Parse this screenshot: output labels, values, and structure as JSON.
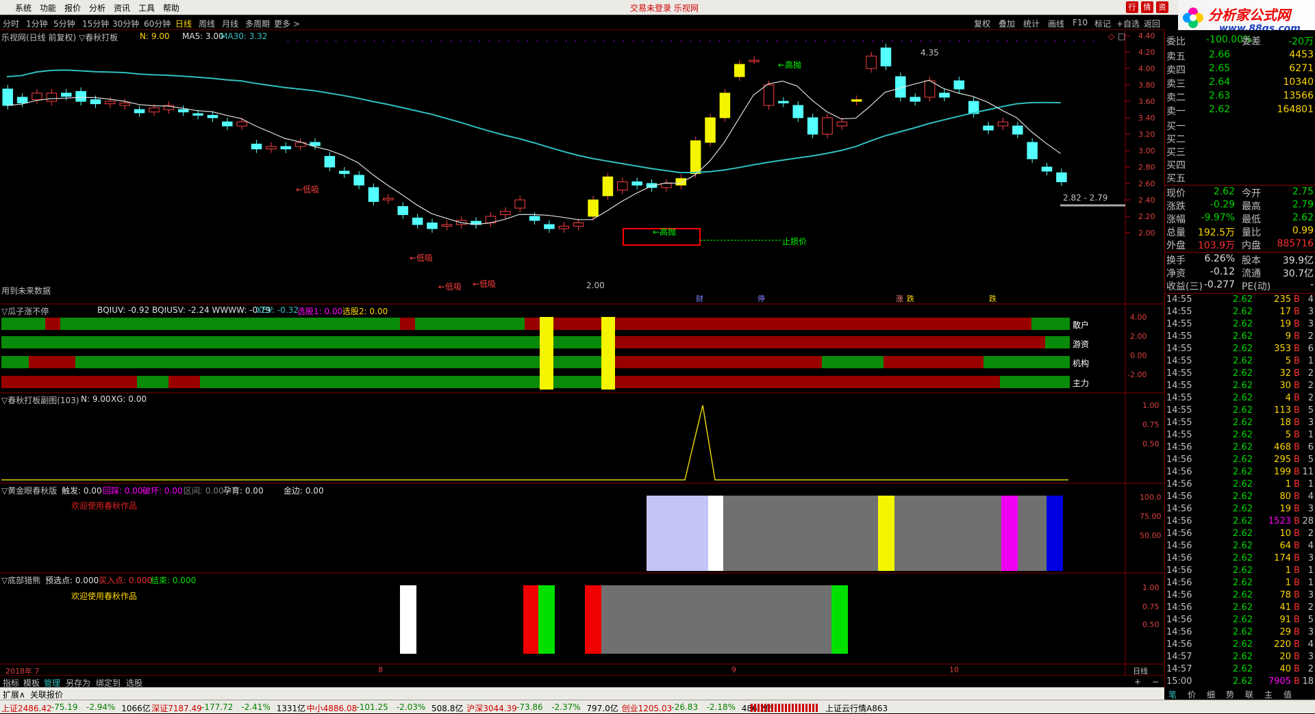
{
  "menu": {
    "items": [
      "系统",
      "功能",
      "报价",
      "分析",
      "资讯",
      "工具",
      "帮助"
    ],
    "title": "交易未登录 乐视网",
    "btn_trade": "行",
    "btn_info": "情",
    "btn_zi": "资"
  },
  "logo": {
    "text": "分析家公式网",
    "url": "www.88gs.com"
  },
  "tabs": {
    "periods": [
      "分时",
      "1分钟",
      "5分钟",
      "15分钟",
      "30分钟",
      "60分钟",
      "日线",
      "周线",
      "月线",
      "多周期",
      "更多 >"
    ],
    "right": [
      "复权",
      "叠加",
      "统计",
      "画线",
      "F10",
      "标记",
      "+自选",
      "返回"
    ]
  },
  "main": {
    "title": "乐视网(日线 前复权) ▽春秋打板",
    "n_label": "N: 9.00",
    "ma5": "MA5: 3.00",
    "ma30": "MA30: 3.32",
    "future_note": "用到未来数据",
    "annotations": {
      "high_sell1": "←高抛",
      "high_sell2": "←高抛",
      "low_buy1": "←低吸",
      "low_buy2": "←低吸",
      "low_buy3": "←低吸",
      "low_buy4": "←低吸",
      "stop": "止损价",
      "peak": "4.35",
      "trough": "2.00",
      "last": "2.82 - 2.79"
    },
    "markers": [
      "财",
      "停",
      "涨",
      "跌",
      "跌"
    ],
    "yticks": [
      "4.40",
      "4.20",
      "4.00",
      "3.80",
      "3.60",
      "3.40",
      "3.20",
      "3.00",
      "2.80",
      "2.60",
      "2.40",
      "2.20",
      "2.00"
    ]
  },
  "panel2": {
    "title": "▽瓜子涨不停",
    "stats": "BQIUV: -0.92 BQIUSV: -2.24 WWWW: -0.79",
    "xev": "XEV: -0.32",
    "xg1": "选股1: 0.00",
    "xg2": "选股2: 0.00",
    "rows": [
      "散户",
      "游资",
      "机构",
      "主力"
    ],
    "yticks": [
      "4.00",
      "2.00",
      "0.00",
      "-2.00"
    ]
  },
  "panel3": {
    "title": "▽春秋打板副图(103)",
    "n": "N: 9.00",
    "xg": "XG: 0.00",
    "yticks": [
      "1.00",
      "0.75",
      "0.50"
    ]
  },
  "panel4": {
    "title": "▽黄金眼春秋版",
    "f1": "触发: 0.00",
    "f2": "回踩: 0.00",
    "f3": "破坏: 0.00",
    "f4": "区间: 0.00",
    "f5": "孕育: 0.00",
    "f6": "金边: 0.00",
    "welcome": "欢迎使用春秋作品",
    "yticks": [
      "100.0",
      "75.00",
      "50.00"
    ]
  },
  "panel5": {
    "title": "▽底部猎熊",
    "f1": "预选点: 0.000",
    "f2": "买入点: 0.000",
    "f3": "结束: 0.000",
    "welcome": "欢迎使用春秋作品",
    "yticks": [
      "1.00",
      "0.75",
      "0.50"
    ]
  },
  "xaxis": {
    "labels": [
      "2018年 7",
      "8",
      "9",
      "10"
    ],
    "right": "日线"
  },
  "bottom": {
    "tabs": [
      "指标",
      "模板",
      "管理",
      "另存为",
      "绑定到",
      "选股"
    ],
    "exp": [
      "扩展∧",
      "关联报价"
    ],
    "qtabs": [
      "笔",
      "价",
      "细",
      "势",
      "联",
      "主",
      "值"
    ]
  },
  "quote": {
    "top": {
      "l": "委比",
      "m": "-100.00%",
      "l2": "委差",
      "r": "-20万"
    },
    "sells": [
      {
        "l": "卖五",
        "p": "2.66",
        "v": "4453"
      },
      {
        "l": "卖四",
        "p": "2.65",
        "v": "6271"
      },
      {
        "l": "卖三",
        "p": "2.64",
        "v": "10340"
      },
      {
        "l": "卖二",
        "p": "2.63",
        "v": "13566"
      },
      {
        "l": "卖一",
        "p": "2.62",
        "v": "164801"
      }
    ],
    "buys": [
      "买一",
      "买二",
      "买三",
      "买四",
      "买五"
    ],
    "info": [
      {
        "a": "现价",
        "b": "2.62",
        "c": "今开",
        "d": "2.75"
      },
      {
        "a": "涨跌",
        "b": "-0.29",
        "c": "最高",
        "d": "2.79"
      },
      {
        "a": "涨幅",
        "b": "-9.97%",
        "c": "最低",
        "d": "2.62"
      },
      {
        "a": "总量",
        "b": "192.5万",
        "c": "量比",
        "d": "0.99"
      },
      {
        "a": "外盘",
        "b": "103.9万",
        "c": "内盘",
        "d": "885716"
      }
    ],
    "info2": [
      {
        "a": "换手",
        "b": "6.26%",
        "c": "股本",
        "d": "39.9亿"
      },
      {
        "a": "净资",
        "b": "-0.12",
        "c": "流通",
        "d": "30.7亿"
      },
      {
        "a": "收益(三)",
        "b": "-0.277",
        "c": "PE(动)",
        "d": "-"
      }
    ],
    "ticks": [
      [
        "14:55",
        "2.62",
        "235",
        "B",
        "4"
      ],
      [
        "14:55",
        "2.62",
        "17",
        "B",
        "3"
      ],
      [
        "14:55",
        "2.62",
        "19",
        "B",
        "3"
      ],
      [
        "14:55",
        "2.62",
        "9",
        "B",
        "2"
      ],
      [
        "14:55",
        "2.62",
        "353",
        "B",
        "6"
      ],
      [
        "14:55",
        "2.62",
        "5",
        "B",
        "1"
      ],
      [
        "14:55",
        "2.62",
        "32",
        "B",
        "2"
      ],
      [
        "14:55",
        "2.62",
        "30",
        "B",
        "2"
      ],
      [
        "14:55",
        "2.62",
        "4",
        "B",
        "2"
      ],
      [
        "14:55",
        "2.62",
        "113",
        "B",
        "5"
      ],
      [
        "14:55",
        "2.62",
        "18",
        "B",
        "3"
      ],
      [
        "14:55",
        "2.62",
        "5",
        "B",
        "1"
      ],
      [
        "14:56",
        "2.62",
        "468",
        "B",
        "6"
      ],
      [
        "14:56",
        "2.62",
        "295",
        "B",
        "5"
      ],
      [
        "14:56",
        "2.62",
        "199",
        "B",
        "11"
      ],
      [
        "14:56",
        "2.62",
        "1",
        "B",
        "1"
      ],
      [
        "14:56",
        "2.62",
        "80",
        "B",
        "4"
      ],
      [
        "14:56",
        "2.62",
        "19",
        "B",
        "3"
      ],
      [
        "14:56",
        "2.62",
        "1523",
        "B",
        "28"
      ],
      [
        "14:56",
        "2.62",
        "10",
        "B",
        "2"
      ],
      [
        "14:56",
        "2.62",
        "64",
        "B",
        "4"
      ],
      [
        "14:56",
        "2.62",
        "174",
        "B",
        "3"
      ],
      [
        "14:56",
        "2.62",
        "1",
        "B",
        "1"
      ],
      [
        "14:56",
        "2.62",
        "1",
        "B",
        "1"
      ],
      [
        "14:56",
        "2.62",
        "78",
        "B",
        "3"
      ],
      [
        "14:56",
        "2.62",
        "41",
        "B",
        "2"
      ],
      [
        "14:56",
        "2.62",
        "91",
        "B",
        "5"
      ],
      [
        "14:56",
        "2.62",
        "29",
        "B",
        "3"
      ],
      [
        "14:56",
        "2.62",
        "220",
        "B",
        "4"
      ],
      [
        "14:57",
        "2.62",
        "20",
        "B",
        "3"
      ],
      [
        "14:57",
        "2.62",
        "40",
        "B",
        "2"
      ],
      [
        "15:00",
        "2.62",
        "7905",
        "B",
        "18"
      ]
    ]
  },
  "status": [
    {
      "t": "上证2486.42",
      "c": "#c00"
    },
    {
      "t": "-75.19",
      "c": "#008000"
    },
    {
      "t": "-2.94%",
      "c": "#008000"
    },
    {
      "t": "1066亿",
      "c": "#000"
    },
    {
      "t": "深证7187.49",
      "c": "#c00"
    },
    {
      "t": "-177.72",
      "c": "#008000"
    },
    {
      "t": "-2.41%",
      "c": "#008000"
    },
    {
      "t": "1331亿",
      "c": "#000"
    },
    {
      "t": "中小4886.08",
      "c": "#c00"
    },
    {
      "t": "-101.25",
      "c": "#008000"
    },
    {
      "t": "-2.03%",
      "c": "#008000"
    },
    {
      "t": "508.8亿",
      "c": "#000"
    },
    {
      "t": "沪深3044.39",
      "c": "#c00"
    },
    {
      "t": "-73.86",
      "c": "#008000"
    },
    {
      "t": "-2.37%",
      "c": "#008000"
    },
    {
      "t": "797.0亿",
      "c": "#000"
    },
    {
      "t": "创业1205.03",
      "c": "#c00"
    },
    {
      "t": "-26.83",
      "c": "#008000"
    },
    {
      "t": "-2.18%",
      "c": "#008000"
    },
    {
      "t": "486.2亿",
      "c": "#000"
    },
    {
      "t": "上证云行情A863",
      "c": "#000"
    }
  ],
  "chart_data": {
    "type": "candlestick",
    "title": "乐视网(日线 前复权)",
    "ylim": [
      2.0,
      4.4
    ],
    "candles": [
      [
        3.75,
        3.55
      ],
      [
        3.65,
        3.58
      ],
      [
        3.62,
        3.7
      ],
      [
        3.6,
        3.7
      ],
      [
        3.7,
        3.66
      ],
      [
        3.72,
        3.6
      ],
      [
        3.62,
        3.57
      ],
      [
        3.57,
        3.6
      ],
      [
        3.55,
        3.58
      ],
      [
        3.5,
        3.46
      ],
      [
        3.47,
        3.52
      ],
      [
        3.5,
        3.55
      ],
      [
        3.5,
        3.47
      ],
      [
        3.45,
        3.43
      ],
      [
        3.43,
        3.4
      ],
      [
        3.35,
        3.3
      ],
      [
        3.3,
        3.35
      ],
      [
        3.08,
        3.02
      ],
      [
        3.02,
        3.05
      ],
      [
        3.05,
        3.02
      ],
      [
        3.05,
        3.1
      ],
      [
        3.1,
        3.06
      ],
      [
        2.93,
        2.8
      ],
      [
        2.75,
        2.72
      ],
      [
        2.7,
        2.58
      ],
      [
        2.55,
        2.38
      ],
      [
        2.4,
        2.42
      ],
      [
        2.32,
        2.22
      ],
      [
        2.18,
        2.1
      ],
      [
        2.12,
        2.05
      ],
      [
        2.08,
        2.1
      ],
      [
        2.1,
        2.15
      ],
      [
        2.14,
        2.1
      ],
      [
        2.12,
        2.2
      ],
      [
        2.22,
        2.26
      ],
      [
        2.3,
        2.4
      ],
      [
        2.2,
        2.15
      ],
      [
        2.1,
        2.05
      ],
      [
        2.05,
        2.08
      ],
      [
        2.08,
        2.12
      ],
      [
        2.2,
        2.4
      ],
      [
        2.45,
        2.68
      ],
      [
        2.52,
        2.62
      ],
      [
        2.62,
        2.58
      ],
      [
        2.6,
        2.55
      ],
      [
        2.55,
        2.6
      ],
      [
        2.58,
        2.66
      ],
      [
        2.72,
        3.12
      ],
      [
        3.1,
        3.4
      ],
      [
        3.4,
        3.7
      ],
      [
        3.9,
        4.05
      ],
      [
        4.1,
        4.1
      ],
      [
        3.55,
        3.8
      ],
      [
        3.6,
        3.58
      ],
      [
        3.55,
        3.4
      ],
      [
        3.4,
        3.2
      ],
      [
        3.2,
        3.4
      ],
      [
        3.3,
        3.35
      ],
      [
        3.6,
        3.62
      ],
      [
        4.0,
        4.15
      ],
      [
        4.25,
        4.03
      ],
      [
        3.9,
        3.65
      ],
      [
        3.65,
        3.6
      ],
      [
        3.65,
        3.85
      ],
      [
        3.7,
        3.65
      ],
      [
        3.85,
        3.75
      ],
      [
        3.6,
        3.45
      ],
      [
        3.3,
        3.25
      ],
      [
        3.3,
        3.35
      ],
      [
        3.3,
        3.2
      ],
      [
        3.1,
        2.9
      ],
      [
        2.8,
        2.75
      ],
      [
        2.73,
        2.62
      ]
    ],
    "ma5": "MA5",
    "ma30": "MA30"
  }
}
